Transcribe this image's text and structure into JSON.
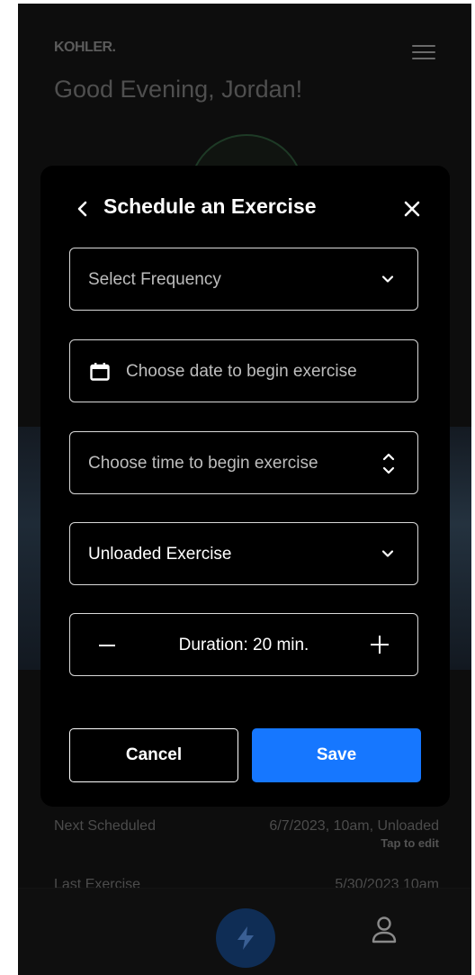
{
  "background": {
    "brand": "KOHLER.",
    "greeting": "Good Evening, Jordan!",
    "next_scheduled": {
      "label": "Next Scheduled",
      "value": "6/7/2023, 10am, Unloaded",
      "action": "Tap to edit"
    },
    "last_exercise": {
      "label": "Last Exercise",
      "value": "5/30/2023 10am"
    },
    "nav": {
      "active_icon": "bolt-icon",
      "profile_icon": "person-icon"
    }
  },
  "modal": {
    "title": "Schedule an Exercise",
    "back_icon": "chevron-left-icon",
    "close_icon": "close-icon",
    "frequency": {
      "placeholder": "Select Frequency"
    },
    "date": {
      "placeholder": "Choose date to begin exercise"
    },
    "time": {
      "placeholder": "Choose time to begin exercise"
    },
    "exercise_type": {
      "value": "Unloaded Exercise"
    },
    "duration": {
      "label": "Duration: 20 min."
    },
    "cancel_label": "Cancel",
    "save_label": "Save"
  },
  "colors": {
    "accent": "#1677ff",
    "modal_bg": "#000000",
    "overlay_text": "#4c4c4c"
  }
}
